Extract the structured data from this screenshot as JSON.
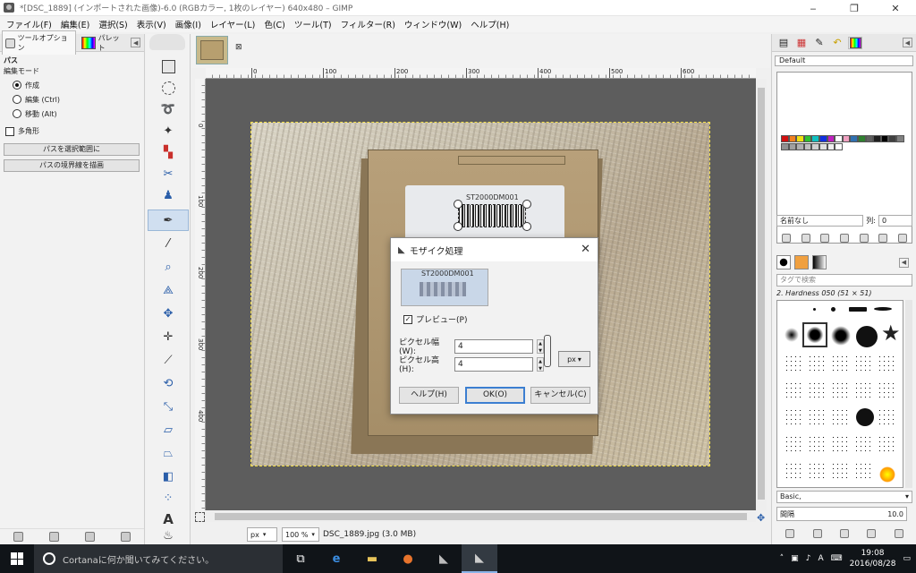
{
  "window": {
    "title": "*[DSC_1889] (インポートされた画像)-6.0 (RGBカラー, 1枚のレイヤー) 640x480 – GIMP",
    "controls": [
      "‒",
      "❐",
      "✕"
    ]
  },
  "menubar": [
    "ファイル(F)",
    "編集(E)",
    "選択(S)",
    "表示(V)",
    "画像(I)",
    "レイヤー(L)",
    "色(C)",
    "ツール(T)",
    "フィルター(R)",
    "ウィンドウ(W)",
    "ヘルプ(H)"
  ],
  "left_dock": {
    "tabs": [
      "ツールオプション",
      "パレット"
    ],
    "tool_title": "パス",
    "edit_mode_label": "編集モード",
    "modes": [
      "作成",
      "編集 (Ctrl)",
      "移動 (Alt)"
    ],
    "selected_mode": "作成",
    "polygon_label": "多角形",
    "buttons": [
      "パスを選択範囲に",
      "パスの境界線を描画"
    ]
  },
  "rulers": {
    "top_labels": [
      "0",
      "100",
      "200",
      "300",
      "400",
      "500",
      "600"
    ],
    "left_labels": [
      "0",
      "100",
      "200",
      "300",
      "400"
    ]
  },
  "image": {
    "label_text": "ST2000DM001",
    "selection_shown": true
  },
  "statusbar": {
    "unit": "px",
    "zoom": "100 %",
    "file": "DSC_1889.jpg (3.0 MB)"
  },
  "right_dock": {
    "palette_name": "Default",
    "name_field": "名前なし",
    "columns_label": "列:",
    "columns_value": "0",
    "tag_search_placeholder": "タグで検索",
    "brush_name": "2. Hardness 050 (51 × 51)",
    "preset": "Basic,",
    "spacing_label": "間隔",
    "spacing_value": "10.0",
    "swatch_colors": [
      "#d01010",
      "#f08020",
      "#f0e010",
      "#30c030",
      "#10c0c0",
      "#1030e0",
      "#c020c0",
      "#ffffff",
      "#f0a0c0",
      "#3070b0",
      "#308030",
      "#606060",
      "#202020",
      "#000000",
      "#404040",
      "#808080",
      "#909090",
      "#a0a0a0",
      "#b0b0b0",
      "#c0c0c0",
      "#d0d0d0",
      "#e0e0e0",
      "#f0f0f0",
      "#ffffff"
    ]
  },
  "dialog": {
    "title": "モザイク処理",
    "preview_label": "プレビュー(P)",
    "preview_checked": true,
    "preview_text": "ST2000DM001",
    "width_label": "ピクセル幅(W):",
    "width_value": "4",
    "height_label": "ピクセル高(H):",
    "height_value": "4",
    "unit": "px",
    "buttons": {
      "help": "ヘルプ(H)",
      "ok": "OK(O)",
      "cancel": "キャンセル(C)"
    }
  },
  "taskbar": {
    "search_placeholder": "Cortanaに何か聞いてみてください。",
    "time": "19:08",
    "date": "2016/08/28"
  }
}
